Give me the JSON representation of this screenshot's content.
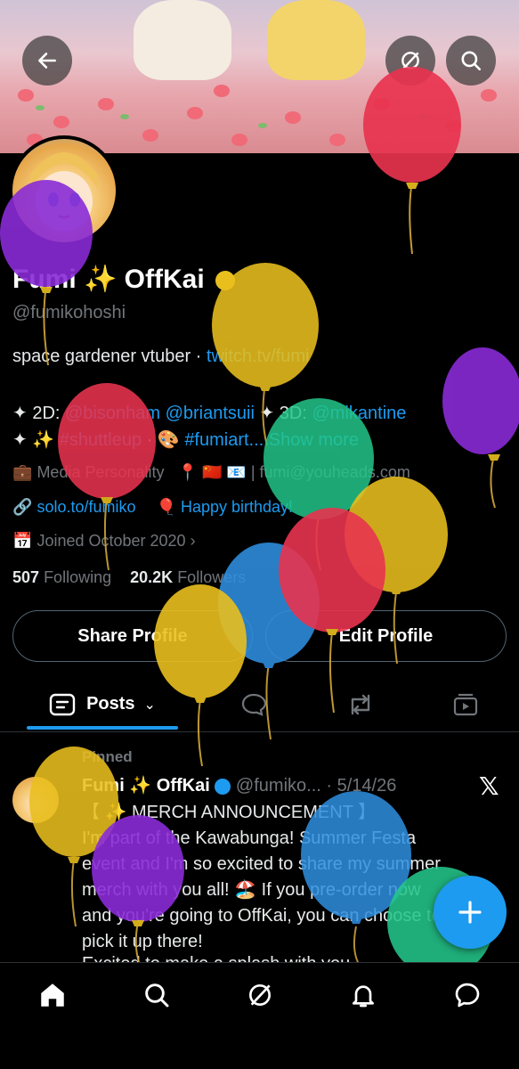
{
  "header": {
    "back_icon": "arrow-left-icon",
    "grok_icon": "grok-slash-icon",
    "search_icon": "search-icon"
  },
  "profile": {
    "name": "Fumi ✨ OffKai",
    "verified": true,
    "handle": "@fumikohoshi",
    "bio_text": "space gardener vtuber · ",
    "bio_link": "twitch.tv/fumi",
    "line2_prefix": "✦ 2D: ",
    "line2_mention1": "@bisonham",
    "line2_mention2": "@briantsuii",
    "line2_mid": " ✦ 3D: ",
    "line2_mention3": "@mikantine",
    "line3_prefix": "✦ ✨ ",
    "line3_tag1": "#shuttleup",
    "line3_mid": " · 🎨 ",
    "line3_tag2": "#fumiart...",
    "line3_more": "Show more",
    "category": "Media Personality",
    "location_flags": "🇨🇳 📧",
    "email": "| fumi@youheads.com",
    "website": "solo.to/fumiko",
    "birthday": "Happy birthday!",
    "joined": "Joined October 2020",
    "following_count": "507",
    "following_label": "Following",
    "followers_count": "20.2K",
    "followers_label": "Followers"
  },
  "actions": {
    "share": "Share Profile",
    "edit": "Edit Profile"
  },
  "tabs": {
    "posts": "Posts"
  },
  "post": {
    "pinned": "Pinned",
    "author": "Fumi ✨ OffKai",
    "handle": "@fumiko...",
    "date": "· 5/14/26",
    "line1": "【 ✨ MERCH ANNOUNCEMENT 】",
    "line2": "I'm part of the Kawabunga! Summer Festa",
    "line3": "event and I'm so excited to share my summer",
    "line4": "merch with you all! 🏖️ If you pre-order now",
    "line5": "and you're going to OffKai, you can choose to",
    "line6": "pick it up there!",
    "line7": "Excited to make a splash with you"
  },
  "colors": {
    "accent": "#1d9bf0",
    "muted": "#71767b",
    "balloon_red": "#e8334f",
    "balloon_yellow": "#e9bf1e",
    "balloon_purple": "#8a2bd6",
    "balloon_blue": "#2f8fe0",
    "balloon_green": "#23c58a"
  },
  "nav": [
    "home-icon",
    "search-icon",
    "grok-icon",
    "notifications-icon",
    "messages-icon"
  ]
}
